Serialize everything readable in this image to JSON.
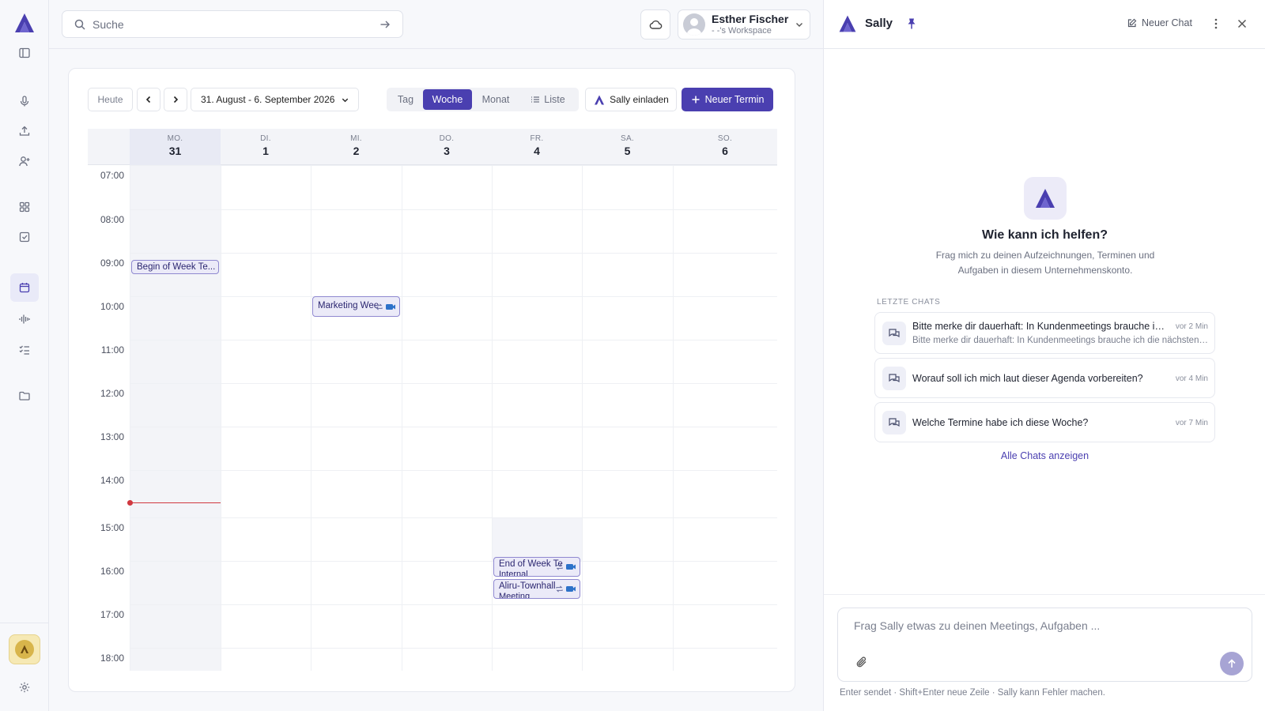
{
  "search": {
    "placeholder": "Suche"
  },
  "user": {
    "name": "Esther Fischer",
    "workspace": "- -'s Workspace"
  },
  "toolbar": {
    "today": "Heute",
    "range": "31. August - 6. September 2026",
    "views": [
      "Tag",
      "Woche",
      "Monat",
      "Liste"
    ],
    "active_view": "Woche",
    "invite": "Sally einladen",
    "new_event": "Neuer Termin"
  },
  "days": [
    {
      "name": "MO.",
      "num": "31"
    },
    {
      "name": "DI.",
      "num": "1"
    },
    {
      "name": "MI.",
      "num": "2"
    },
    {
      "name": "DO.",
      "num": "3"
    },
    {
      "name": "FR.",
      "num": "4"
    },
    {
      "name": "SA.",
      "num": "5"
    },
    {
      "name": "SO.",
      "num": "6"
    }
  ],
  "times": [
    "07:00",
    "08:00",
    "09:00",
    "10:00",
    "11:00",
    "12:00",
    "13:00",
    "14:00",
    "15:00",
    "16:00",
    "17:00",
    "18:00"
  ],
  "events": [
    {
      "title": "Begin of Week Te...",
      "sub": ""
    },
    {
      "title": "Marketing Wee",
      "sub": ""
    },
    {
      "title": "End of Week Te",
      "sub": "Internal"
    },
    {
      "title": "Aliru-Townhall",
      "sub": "Meeting"
    }
  ],
  "panel": {
    "title": "Sally",
    "new_chat": "Neuer Chat",
    "hero_title": "Wie kann ich helfen?",
    "hero_sub": "Frag mich zu deinen Aufzeichnungen, Terminen und Aufgaben in diesem Unternehmenskonto.",
    "recent_heading": "LETZTE CHATS",
    "chats": [
      {
        "title": "Bitte merke dir dauerhaft: In Kundenmeetings brauche ich ...",
        "snippet": "Bitte merke dir dauerhaft: In Kundenmeetings brauche ich die nächsten S...",
        "time": "vor 2 Min"
      },
      {
        "title": "Worauf soll ich mich laut dieser Agenda vorbereiten?",
        "snippet": "",
        "time": "vor 4 Min"
      },
      {
        "title": "Welche Termine habe ich diese Woche?",
        "snippet": "",
        "time": "vor 7 Min"
      }
    ],
    "all_chats": "Alle Chats anzeigen",
    "composer_placeholder": "Frag Sally etwas zu deinen Meetings, Aufgaben ...",
    "hint": "Enter sendet · Shift+Enter neue Zeile · Sally kann Fehler machen."
  },
  "colors": {
    "accent": "#4a3fb0",
    "now_line": "#d0383f",
    "event_bg": "#ebeaf8"
  }
}
